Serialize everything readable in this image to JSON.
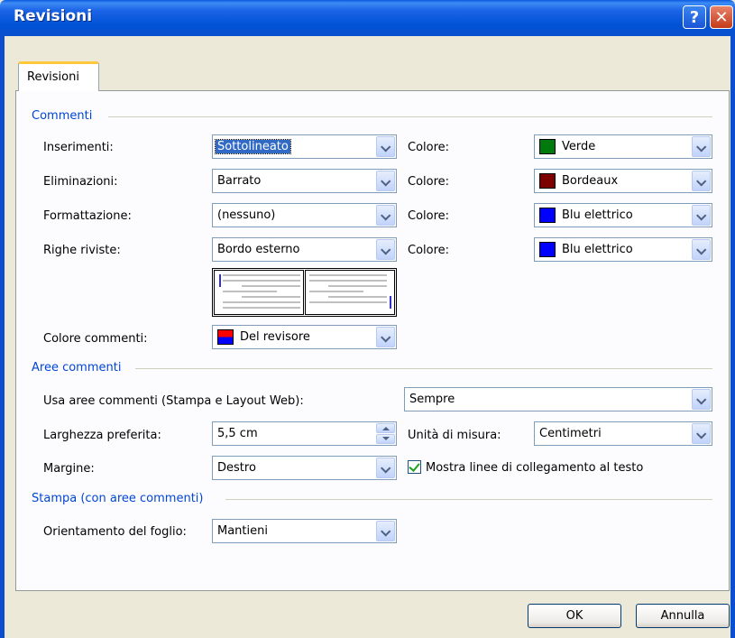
{
  "window": {
    "title": "Revisioni",
    "help_label": "?",
    "close_label": "✕"
  },
  "tab": {
    "label": "Revisioni"
  },
  "commenti": {
    "heading": "Commenti",
    "inserimenti": {
      "label": "Inserimenti:",
      "value": "Sottolineato",
      "color_label": "Colore:",
      "color_value": "Verde",
      "color": "#007a0c"
    },
    "eliminazioni": {
      "label": "Eliminazioni:",
      "value": "Barrato",
      "color_label": "Colore:",
      "color_value": "Bordeaux",
      "color": "#7c0000"
    },
    "formattazione": {
      "label": "Formattazione:",
      "value": "(nessuno)",
      "color_label": "Colore:",
      "color_value": "Blu elettrico",
      "color": "#0000ff"
    },
    "righe": {
      "label": "Righe riviste:",
      "value": "Bordo esterno",
      "color_label": "Colore:",
      "color_value": "Blu elettrico",
      "color": "#0000ff"
    },
    "colore_commenti": {
      "label": "Colore commenti:",
      "value": "Del revisore",
      "swatch_top": "#ff0000",
      "swatch_bottom": "#0000ff"
    }
  },
  "aree": {
    "heading": "Aree commenti",
    "usa": {
      "label": "Usa aree commenti (Stampa e Layout Web):",
      "value": "Sempre"
    },
    "larghezza": {
      "label": "Larghezza preferita:",
      "value": "5,5 cm"
    },
    "unita": {
      "label": "Unità di misura:",
      "value": "Centimetri"
    },
    "margine": {
      "label": "Margine:",
      "value": "Destro"
    },
    "mostra_linee": {
      "label": "Mostra linee di collegamento al testo",
      "checked": true
    }
  },
  "stampa": {
    "heading": "Stampa (con aree commenti)",
    "orientamento": {
      "label": "Orientamento del foglio:",
      "value": "Mantieni"
    }
  },
  "buttons": {
    "ok": "OK",
    "cancel": "Annulla"
  }
}
